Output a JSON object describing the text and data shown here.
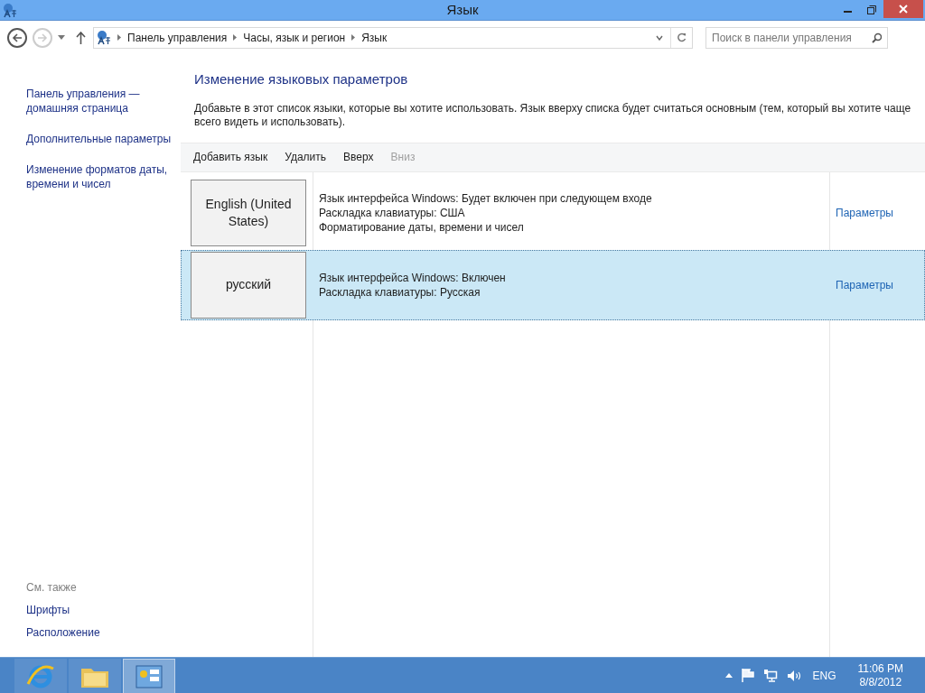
{
  "window": {
    "title": "Язык"
  },
  "address_bar": {
    "breadcrumbs": [
      "Панель управления",
      "Часы, язык и регион",
      "Язык"
    ]
  },
  "search": {
    "placeholder": "Поиск в панели управления"
  },
  "sidebar": {
    "links": [
      "Панель управления — домашняя страница",
      "Дополнительные параметры",
      "Изменение форматов даты, времени и чисел"
    ],
    "see_also": {
      "heading": "См. также",
      "links": [
        "Шрифты",
        "Расположение"
      ]
    }
  },
  "main": {
    "heading": "Изменение языковых параметров",
    "description": "Добавьте в этот список языки, которые вы хотите использовать. Язык вверху списка будет считаться основным (тем, который вы хотите чаще всего видеть и использовать)."
  },
  "toolbar": [
    {
      "label": "Добавить язык",
      "disabled": false
    },
    {
      "label": "Удалить",
      "disabled": false
    },
    {
      "label": "Вверх",
      "disabled": false
    },
    {
      "label": "Вниз",
      "disabled": true
    }
  ],
  "languages": [
    {
      "name": "English (United States)",
      "details": [
        "Язык интерфейса Windows: Будет включен при следующем входе",
        "Раскладка клавиатуры: США",
        "Форматирование даты, времени и чисел"
      ],
      "options_link": "Параметры",
      "selected": false
    },
    {
      "name": "русский",
      "details": [
        "Язык интерфейса Windows: Включен",
        "Раскладка клавиатуры: Русская"
      ],
      "options_link": "Параметры",
      "selected": true
    }
  ],
  "taskbar": {
    "apps": [
      {
        "kind": "browser",
        "active": false
      },
      {
        "kind": "folder",
        "active": false
      },
      {
        "kind": "control-panel",
        "active": true
      }
    ],
    "tray": {
      "language": "ENG",
      "time": "11:06 PM",
      "date": "8/8/2012"
    }
  }
}
